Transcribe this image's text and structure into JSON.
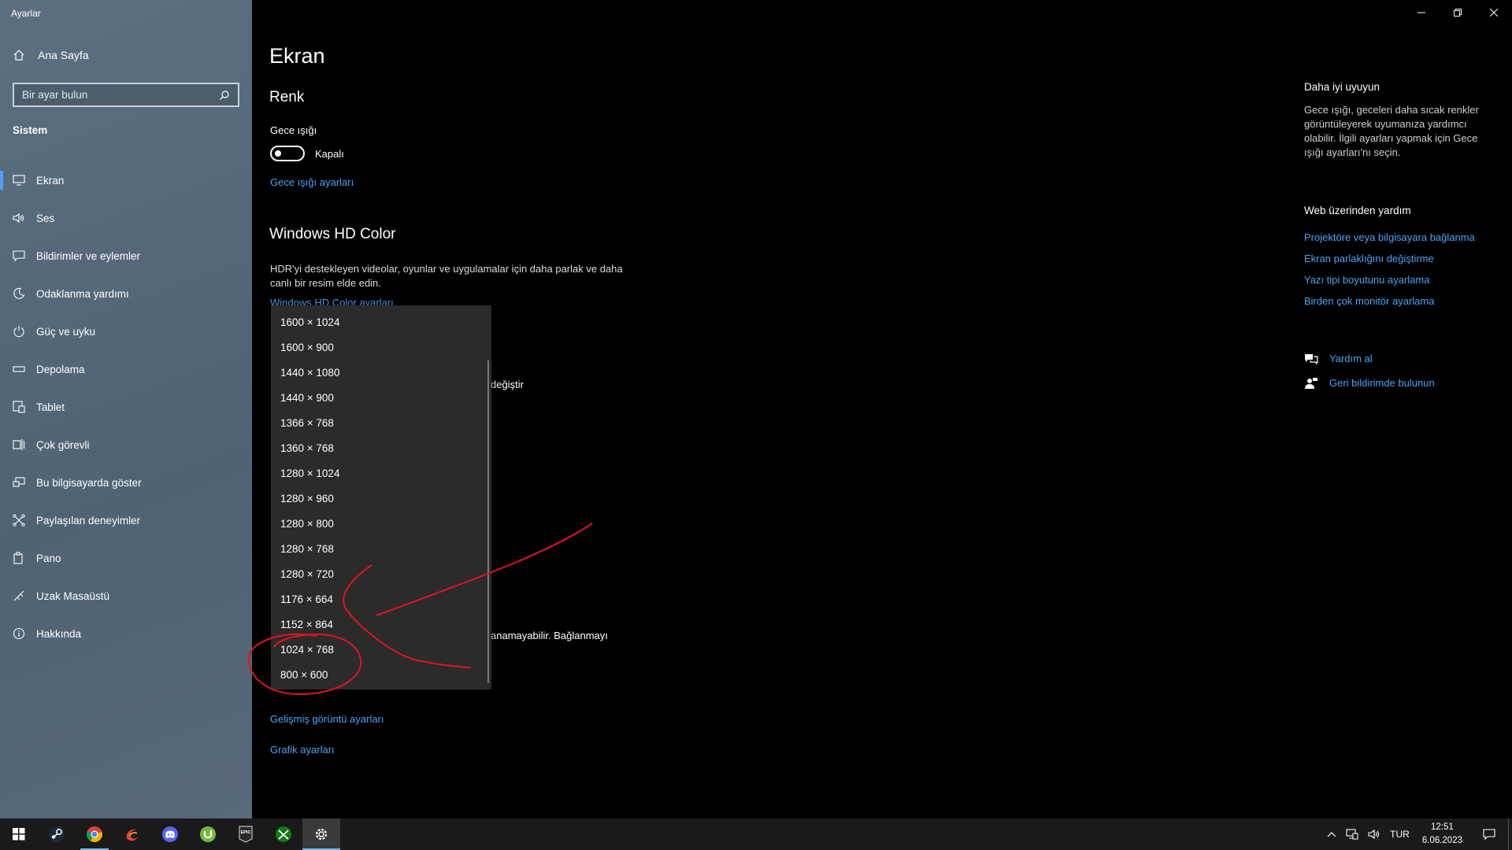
{
  "window": {
    "title": "Ayarlar"
  },
  "sidebar": {
    "home_label": "Ana Sayfa",
    "search_placeholder": "Bir ayar bulun",
    "section_label": "Sistem",
    "items": [
      {
        "label": "Ekran",
        "icon": "monitor-icon"
      },
      {
        "label": "Ses",
        "icon": "speaker-icon"
      },
      {
        "label": "Bildirimler ve eylemler",
        "icon": "notification-icon"
      },
      {
        "label": "Odaklanma yardımı",
        "icon": "moon-icon"
      },
      {
        "label": "Güç ve uyku",
        "icon": "power-icon"
      },
      {
        "label": "Depolama",
        "icon": "storage-icon"
      },
      {
        "label": "Tablet",
        "icon": "tablet-icon"
      },
      {
        "label": "Çok görevli",
        "icon": "multitask-icon"
      },
      {
        "label": "Bu bilgisayarda göster",
        "icon": "project-icon"
      },
      {
        "label": "Paylaşılan deneyimler",
        "icon": "shared-icon"
      },
      {
        "label": "Pano",
        "icon": "clipboard-icon"
      },
      {
        "label": "Uzak Masaüstü",
        "icon": "remote-icon"
      },
      {
        "label": "Hakkında",
        "icon": "info-icon"
      }
    ]
  },
  "main": {
    "title": "Ekran",
    "color_heading": "Renk",
    "night_light_label": "Gece ışığı",
    "night_light_state": "Kapalı",
    "night_light_settings_link": "Gece ışığı ayarları",
    "hd_heading": "Windows HD Color",
    "hd_description": "HDR'yi destekleyen videolar, oyunlar ve uygulamalar için daha parlak ve daha canlı bir resim elde edin.",
    "hd_settings_link": "Windows HD Color ayarları",
    "partial_text_1": "değiştir",
    "partial_text_2": "anamayabilir. Bağlanmayı",
    "advanced_link": "Gelişmiş görüntü ayarları",
    "graphics_link": "Grafik ayarları"
  },
  "resolution_dropdown": {
    "options": [
      "1600 × 1024",
      "1600 × 900",
      "1440 × 1080",
      "1440 × 900",
      "1366 × 768",
      "1360 × 768",
      "1280 × 1024",
      "1280 × 960",
      "1280 × 800",
      "1280 × 768",
      "1280 × 720",
      "1176 × 664",
      "1152 × 864",
      "1024 × 768",
      "800 × 600"
    ]
  },
  "right_pane": {
    "tip_title": "Daha iyi uyuyun",
    "tip_text": "Gece ışığı, geceleri daha sıcak renkler görüntüleyerek uyumanıza yardımcı olabilir. İlgili ayarları yapmak için Gece ışığı ayarları'nı seçin.",
    "web_help_title": "Web üzerinden yardım",
    "web_links": [
      "Projektöre veya bilgisayara bağlanma",
      "Ekran parlaklığını değiştirme",
      "Yazı tipi boyutunu ayarlama",
      "Birden çok monitör ayarlama"
    ],
    "get_help": "Yardım al",
    "feedback": "Geri bildirimde bulunun"
  },
  "taskbar": {
    "language": "TUR",
    "time": "12:51",
    "date": "6.06.2023"
  },
  "colors": {
    "accent": "#4ea1f3",
    "annotation": "#e0141e"
  }
}
